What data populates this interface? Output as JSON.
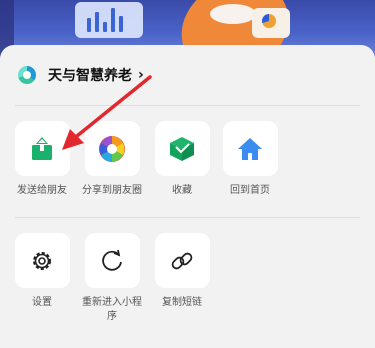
{
  "header": {
    "title": "天与智慧养老",
    "chevron": "›"
  },
  "row1": [
    {
      "label": "发送给朋友",
      "icon": "share-upload-icon"
    },
    {
      "label": "分享到朋友圈",
      "icon": "moments-aperture-icon"
    },
    {
      "label": "收藏",
      "icon": "favorite-cube-icon"
    },
    {
      "label": "回到首页",
      "icon": "home-icon"
    }
  ],
  "row2": [
    {
      "label": "设置",
      "icon": "gear-icon"
    },
    {
      "label": "重新进入小程序",
      "icon": "reload-icon"
    },
    {
      "label": "复制短链",
      "icon": "link-icon"
    }
  ],
  "colors": {
    "accent_green": "#19b16b",
    "home_blue": "#3a8cf0",
    "annotation_red": "#e0282e"
  }
}
